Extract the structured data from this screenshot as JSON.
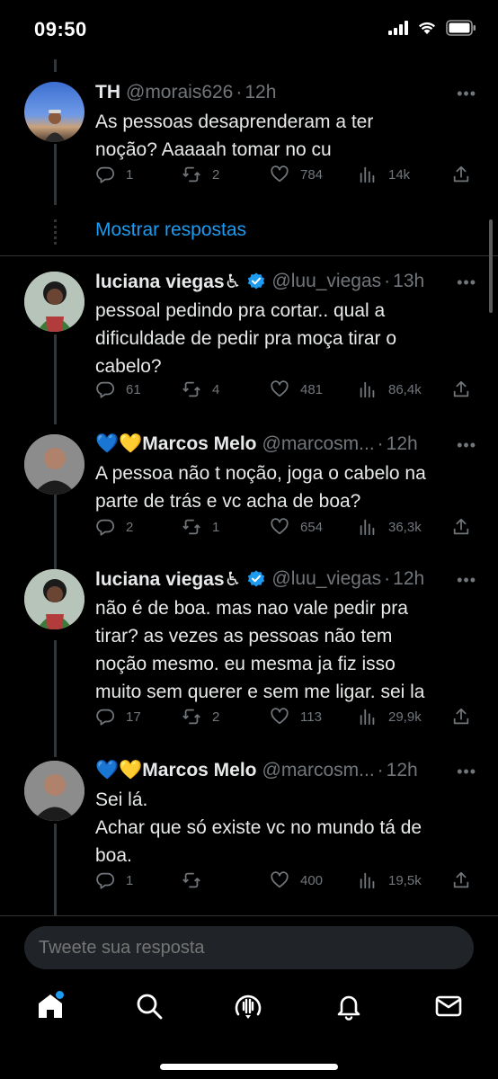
{
  "status": {
    "time": "09:50"
  },
  "show_replies_label": "Mostrar respostas",
  "tweets": [
    {
      "name": "TH",
      "handle": "@morais626",
      "time": "12h",
      "text": "As pessoas desaprenderam a ter\nnoção? Aaaaah tomar no cu",
      "replies": "1",
      "retweets": "2",
      "likes": "784",
      "views": "14k"
    },
    {
      "name": "luciana viegas♿",
      "handle": "@luu_viegas",
      "time": "13h",
      "verified": true,
      "text": "pessoal pedindo pra cortar.. qual a\ndificuldade de pedir pra moça tirar o\ncabelo?",
      "replies": "61",
      "retweets": "4",
      "likes": "481",
      "views": "86,4k"
    },
    {
      "name": "💙💛Marcos Melo",
      "handle": "@marcosm...",
      "time": "12h",
      "text": "A pessoa não t noção, joga o cabelo na\nparte de trás e vc acha de boa?",
      "replies": "2",
      "retweets": "1",
      "likes": "654",
      "views": "36,3k"
    },
    {
      "name": "luciana viegas♿",
      "handle": "@luu_viegas",
      "time": "12h",
      "verified": true,
      "text": "não é de boa. mas nao vale pedir pra\ntirar? as vezes as pessoas não tem\nnoção mesmo. eu mesma ja fiz isso\nmuito sem querer e sem me ligar. sei la",
      "replies": "17",
      "retweets": "2",
      "likes": "113",
      "views": "29,9k"
    },
    {
      "name": "💙💛Marcos Melo",
      "handle": "@marcosm...",
      "time": "12h",
      "text": "Sei lá.\nAchar que só existe vc no mundo tá de\nboa.",
      "replies": "1",
      "retweets": "",
      "likes": "400",
      "views": "19,5k"
    }
  ],
  "reply": {
    "placeholder": "Tweete sua resposta"
  },
  "colors": {
    "accent": "#1d9bf0",
    "muted": "#71767b",
    "background": "#000000",
    "verified": "#1d9bf0"
  },
  "icons": [
    "home-icon",
    "search-icon",
    "spaces-icon",
    "notifications-icon",
    "messages-icon"
  ]
}
